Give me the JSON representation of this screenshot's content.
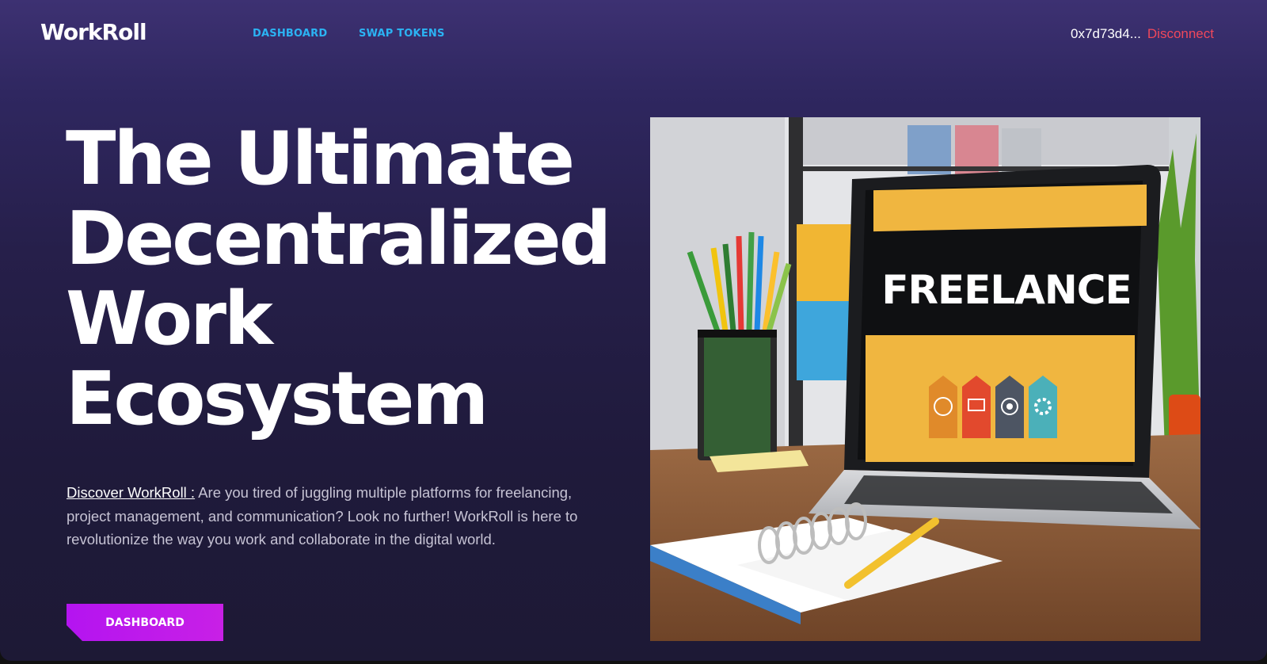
{
  "app": {
    "name": "WorkRoll"
  },
  "nav": {
    "links": [
      {
        "label": "DASHBOARD"
      },
      {
        "label": "SWAP TOKENS"
      }
    ],
    "wallet_address": "0x7d73d4...",
    "disconnect_label": "Disconnect"
  },
  "hero": {
    "title_lines": [
      "The Ultimate",
      "Decentralized",
      "Work",
      "Ecosystem"
    ],
    "description_lead": "Discover WorkRoll :",
    "description_body": "Are you tired of juggling multiple platforms for freelancing, project management, and communication? Look no further! WorkRoll is here to revolutionize the way you work and collaborate in the digital world.",
    "cta_label": "DASHBOARD",
    "image": {
      "screen_text": "FREELANCE",
      "subject": "laptop-freelance-desk-photo"
    }
  },
  "colors": {
    "nav_link": "#2bb3f3",
    "disconnect": "#f0485b",
    "cta_start": "#b414f0",
    "cta_end": "#c820e6",
    "background_top": "#3d3172",
    "background_bottom": "#1d1935"
  },
  "icons": [
    "globe-icon",
    "presentation-icon",
    "target-icon",
    "gear-icon"
  ]
}
